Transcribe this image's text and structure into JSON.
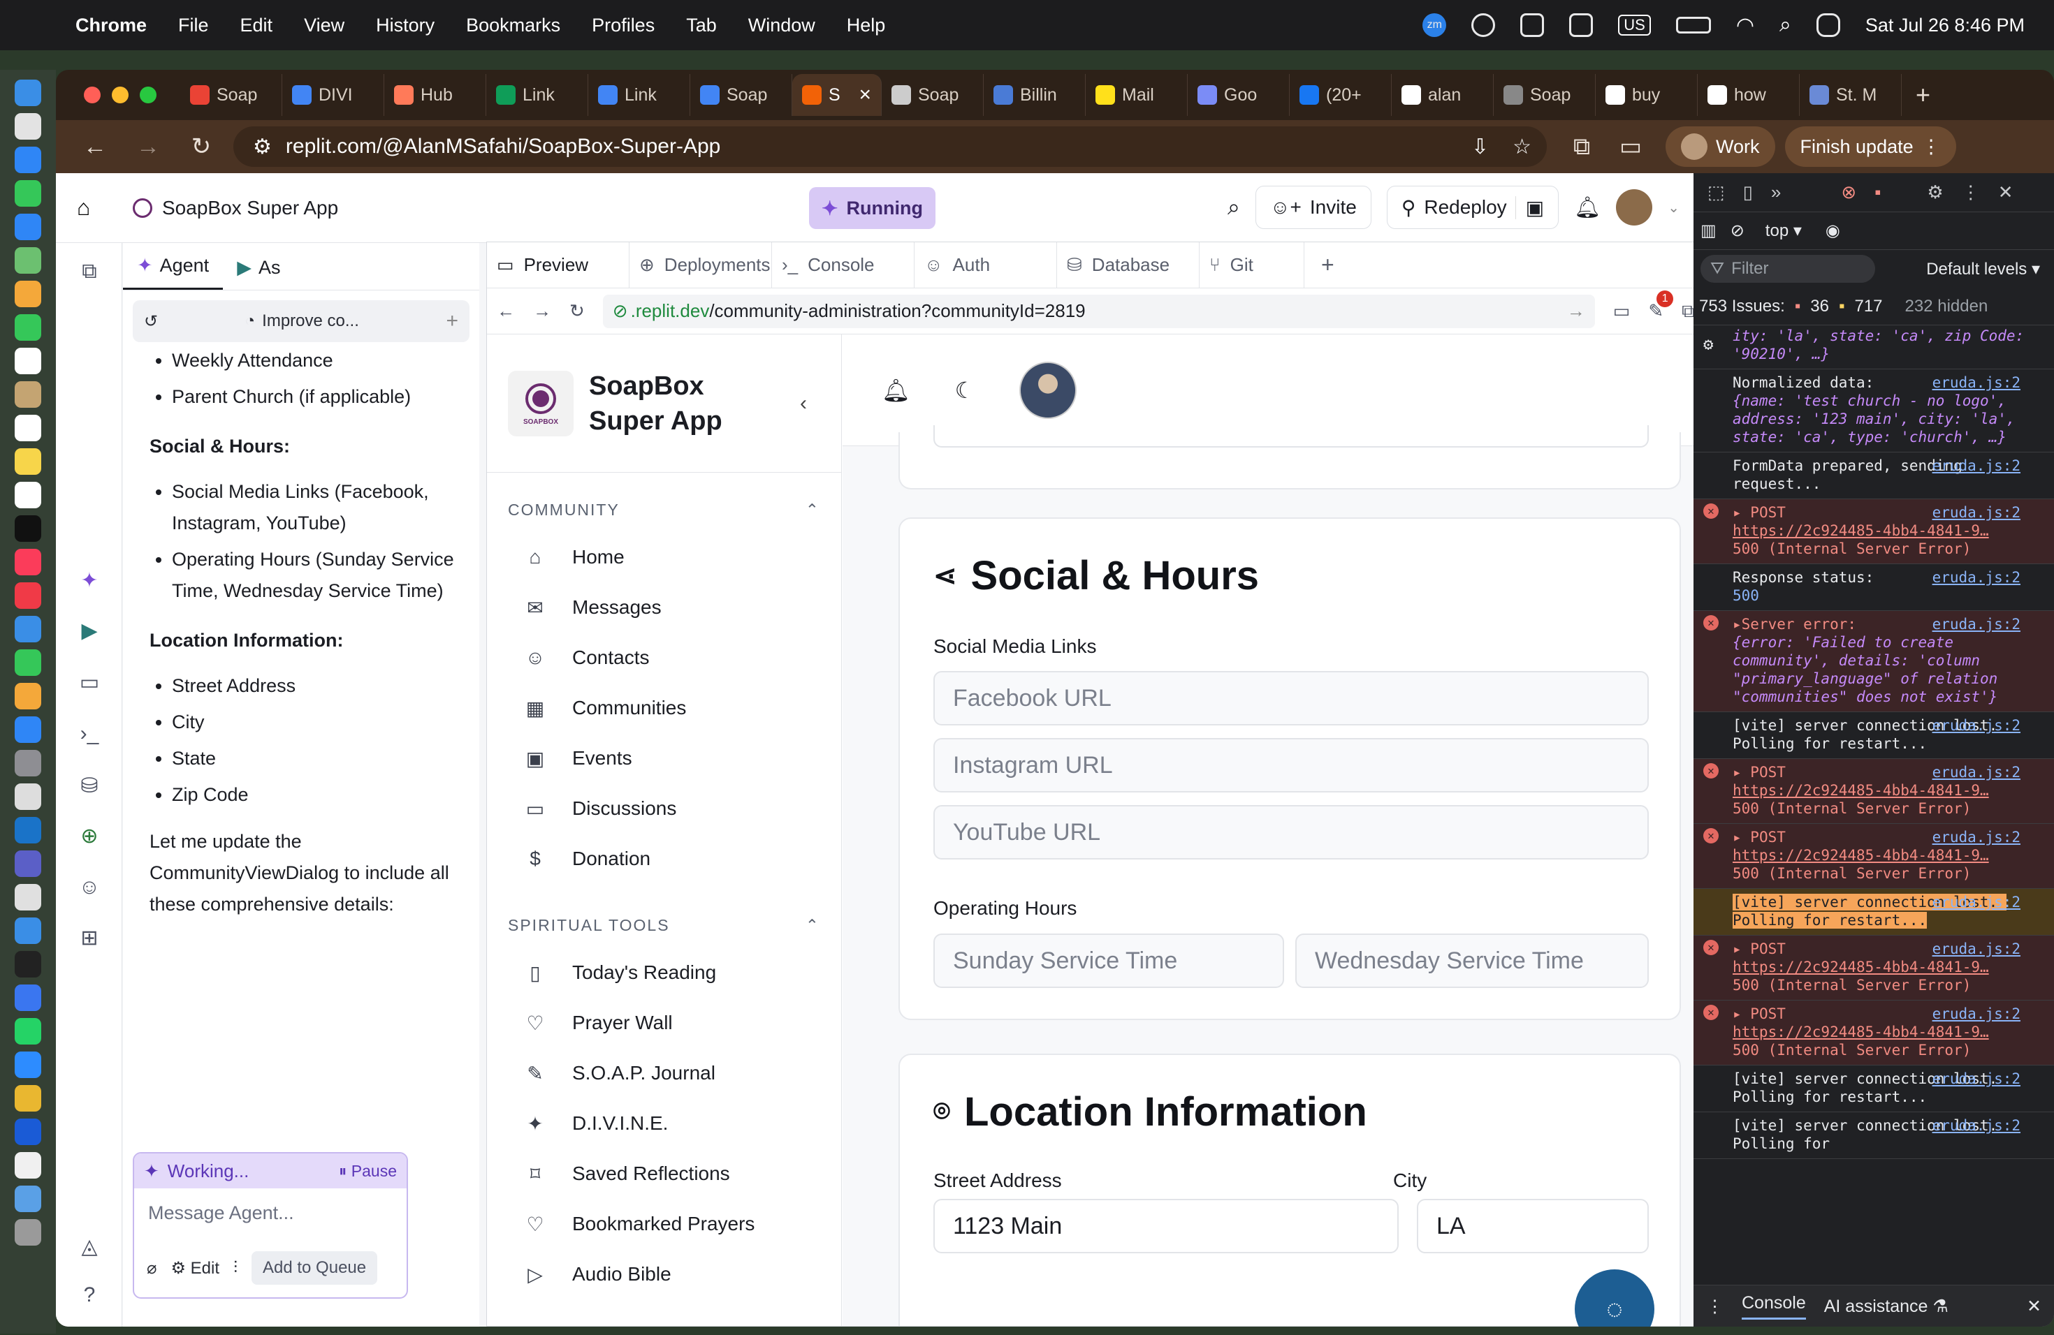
{
  "menubar": {
    "app": "Chrome",
    "items": [
      "File",
      "Edit",
      "View",
      "History",
      "Bookmarks",
      "Profiles",
      "Tab",
      "Window",
      "Help"
    ],
    "input_source": "US",
    "clock": "Sat Jul 26  8:46 PM"
  },
  "browser": {
    "tabs": [
      "Soap",
      "DIVI",
      "Hub",
      "Link",
      "Link",
      "Soap",
      "S",
      "Soap",
      "Billin",
      "Mail",
      "Goo",
      "(20+",
      "alan",
      "Soap",
      "buy",
      "how",
      "St. M"
    ],
    "url": "replit.com/@AlanMSafahi/SoapBox-Super-App",
    "work_label": "Work",
    "finish_update_label": "Finish update"
  },
  "replit": {
    "project_title": "SoapBox Super App",
    "status": "Running",
    "invite_label": "Invite",
    "redeploy_label": "Redeploy",
    "agent_tab": "Agent",
    "assistant_tab": "As",
    "thread_title": "Improve co...",
    "message": {
      "list1": [
        "Weekly Attendance",
        "Parent Church (if applicable)"
      ],
      "heading_social": "Social & Hours:",
      "list_social": [
        "Social Media Links (Facebook, Instagram, YouTube)",
        "Operating Hours (Sunday Service Time, Wednesday Service Time)"
      ],
      "heading_location": "Location Information:",
      "list_location": [
        "Street Address",
        "City",
        "State",
        "Zip Code"
      ],
      "paragraph": "Let me update the CommunityViewDialog to include all these comprehensive details:"
    },
    "composer": {
      "working": "Working...",
      "pause": "Pause",
      "placeholder": "Message Agent...",
      "edit": "Edit",
      "queue": "Add to Queue"
    },
    "preview_tabs": [
      "Preview",
      "Deployments",
      "Console",
      "Auth",
      "Database",
      "Git"
    ],
    "preview_url_domain": ".replit.dev",
    "preview_url_path": "/community-administration?communityId=2819",
    "notification_count": "1"
  },
  "app": {
    "brand": "SoapBox Super App",
    "logo_text": "SOAPBOX",
    "section_community": "COMMUNITY",
    "community_items": [
      "Home",
      "Messages",
      "Contacts",
      "Communities",
      "Events",
      "Discussions",
      "Donation"
    ],
    "section_spiritual": "SPIRITUAL TOOLS",
    "spiritual_items": [
      "Today's Reading",
      "Prayer Wall",
      "S.O.A.P. Journal",
      "D.I.V.I.N.E.",
      "Saved Reflections",
      "Bookmarked Prayers",
      "Audio Bible"
    ],
    "social_title": "Social & Hours",
    "social_label": "Social Media Links",
    "facebook_ph": "Facebook URL",
    "instagram_ph": "Instagram URL",
    "youtube_ph": "YouTube URL",
    "hours_label": "Operating Hours",
    "sunday_ph": "Sunday Service Time",
    "wednesday_ph": "Wednesday Service Time",
    "location_title": "Location Information",
    "street_label": "Street Address",
    "street_value": "1123 Main",
    "city_label": "City",
    "city_value": "LA"
  },
  "devtools": {
    "context": "top",
    "filter": "Filter",
    "levels": "Default levels",
    "issues_label": "753 Issues:",
    "errors": "36",
    "warnings": "717",
    "hidden": "232 hidden",
    "logs": [
      {
        "type": "info",
        "text": "ity: 'la', state: 'ca', zip Code: '90210', …}"
      },
      {
        "type": "info",
        "text": "Normalized data:",
        "src": "eruda.js:2",
        "detail": "{name: 'test church - no logo', address: '123 main', city: 'la', state: 'ca', type: 'church', …}"
      },
      {
        "type": "info",
        "text": "FormData prepared, sending request...",
        "src": "eruda.js:2"
      },
      {
        "type": "err",
        "text": "POST",
        "src": "eruda.js:2",
        "link": "https://2c924485-4bb4-4841-9…",
        "detail": "500 (Internal Server Error)"
      },
      {
        "type": "info",
        "text": "Response status:",
        "src": "eruda.js:2",
        "detail": "500"
      },
      {
        "type": "err",
        "text": "Server error:",
        "src": "eruda.js:2",
        "detail": "{error: 'Failed to create community', details: 'column \"primary_language\" of relation \"communities\" does not exist'}"
      },
      {
        "type": "info",
        "text": "[vite] server connection lost. Polling for restart...",
        "src": "eruda.js:2"
      },
      {
        "type": "err",
        "text": "POST",
        "src": "eruda.js:2",
        "link": "https://2c924485-4bb4-4841-9…",
        "detail": "500 (Internal Server Error)"
      },
      {
        "type": "err",
        "text": "POST",
        "src": "eruda.js:2",
        "link": "https://2c924485-4bb4-4841-9…",
        "detail": "500 (Internal Server Error)"
      },
      {
        "type": "warn",
        "text": "[vite] server connection lost. Polling for restart...",
        "src": "eruda.js:2"
      },
      {
        "type": "err",
        "text": "POST",
        "src": "eruda.js:2",
        "link": "https://2c924485-4bb4-4841-9…",
        "detail": "500 (Internal Server Error)"
      },
      {
        "type": "err",
        "text": "POST",
        "src": "eruda.js:2",
        "link": "https://2c924485-4bb4-4841-9…",
        "detail": "500 (Internal Server Error)"
      },
      {
        "type": "info",
        "text": "[vite] server connection lost. Polling for restart...",
        "src": "eruda.js:2"
      },
      {
        "type": "info",
        "text": "[vite] server connection lost. Polling for",
        "src": "eruda.js:2"
      }
    ],
    "bottom_console": "Console",
    "bottom_ai": "AI assistance"
  },
  "colors": {
    "accent": "#7c4dd6",
    "error": "#f28b82",
    "fab": "#1d5e93"
  }
}
